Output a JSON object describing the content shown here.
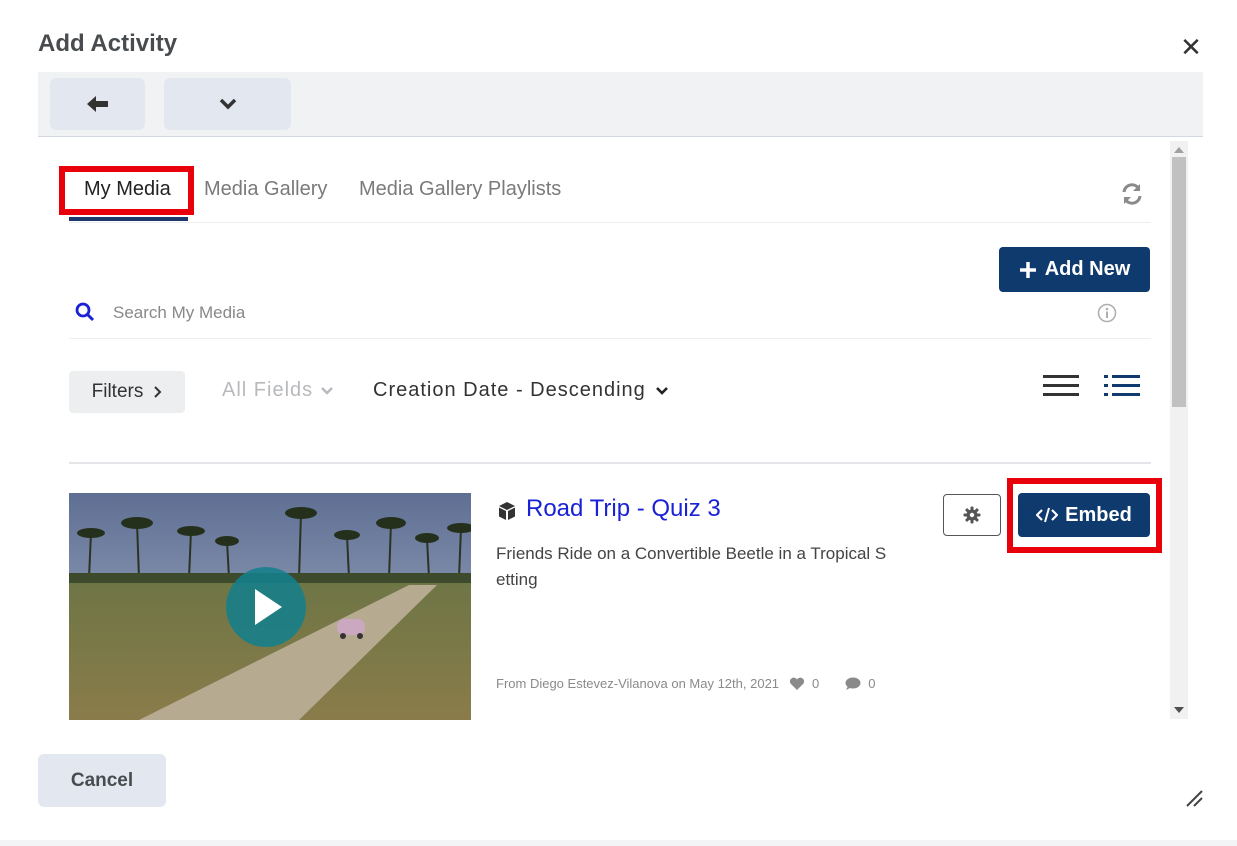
{
  "dialog": {
    "title": "Add Activity",
    "close_icon": "close-icon",
    "toolbar": {
      "back_icon": "arrow-left-icon",
      "menu_icon": "chevron-down-icon"
    },
    "cancel_label": "Cancel",
    "resize_icon": "resize-handle-icon"
  },
  "media": {
    "tabs": [
      {
        "label": "My Media",
        "active": true
      },
      {
        "label": "Media Gallery",
        "active": false
      },
      {
        "label": "Media Gallery Playlists",
        "active": false
      }
    ],
    "refresh_icon": "refresh-icon",
    "add_new_label": "Add New",
    "search": {
      "placeholder": "Search My Media",
      "value": ""
    },
    "filters_label": "Filters",
    "fields_label": "All Fields",
    "sort_label": "Creation Date - Descending",
    "view_icons": [
      "list-view-icon",
      "detailed-view-icon"
    ],
    "entries": [
      {
        "title": "Road Trip - Quiz 3",
        "type_icon": "cube-icon",
        "description": "Friends Ride on a Convertible Beetle in a Tropical Setting",
        "meta": "From Diego Estevez-Vilanova on May 12th, 2021",
        "likes": "0",
        "comments": "0",
        "embed_label": "Embed"
      }
    ]
  },
  "colors": {
    "primary": "#0f3a6e",
    "highlight": "#e8000b",
    "link": "#1a22d6",
    "tab_underline": "#1b3a6b"
  }
}
